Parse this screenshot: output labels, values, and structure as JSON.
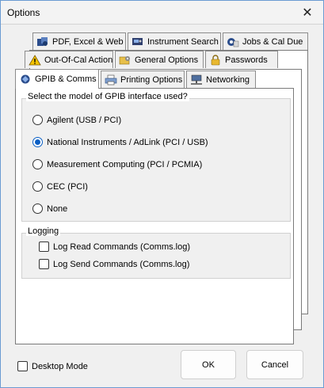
{
  "window": {
    "title": "Options",
    "close_label": "✕"
  },
  "tabs": {
    "row1": [
      "PDF, Excel & Web",
      "Instrument Search",
      "Jobs & Cal Due"
    ],
    "row2": [
      "Out-Of-Cal Action",
      "General Options",
      "Passwords"
    ],
    "row3": [
      "GPIB & Comms",
      "Printing Options",
      "Networking"
    ],
    "active": "GPIB & Comms"
  },
  "gpib": {
    "group_label": "Select the model of GPIB interface used?",
    "options": [
      {
        "label": "Agilent (USB / PCI)",
        "checked": false
      },
      {
        "label": "National Instruments / AdLink (PCI / USB)",
        "checked": true
      },
      {
        "label": "Measurement Computing (PCI / PCMIA)",
        "checked": false
      },
      {
        "label": "CEC (PCI)",
        "checked": false
      },
      {
        "label": "None",
        "checked": false
      }
    ]
  },
  "logging": {
    "group_label": "Logging",
    "options": [
      {
        "label": "Log Read Commands (Comms.log)",
        "checked": false
      },
      {
        "label": "Log Send Commands (Comms.log)",
        "checked": false
      }
    ]
  },
  "footer": {
    "desktop_mode_label": "Desktop Mode",
    "desktop_mode_checked": false,
    "ok_label": "OK",
    "cancel_label": "Cancel"
  },
  "colors": {
    "accent": "#0a5fc4",
    "border": "#7a7a7a",
    "window_bg": "#f0f0f0"
  }
}
